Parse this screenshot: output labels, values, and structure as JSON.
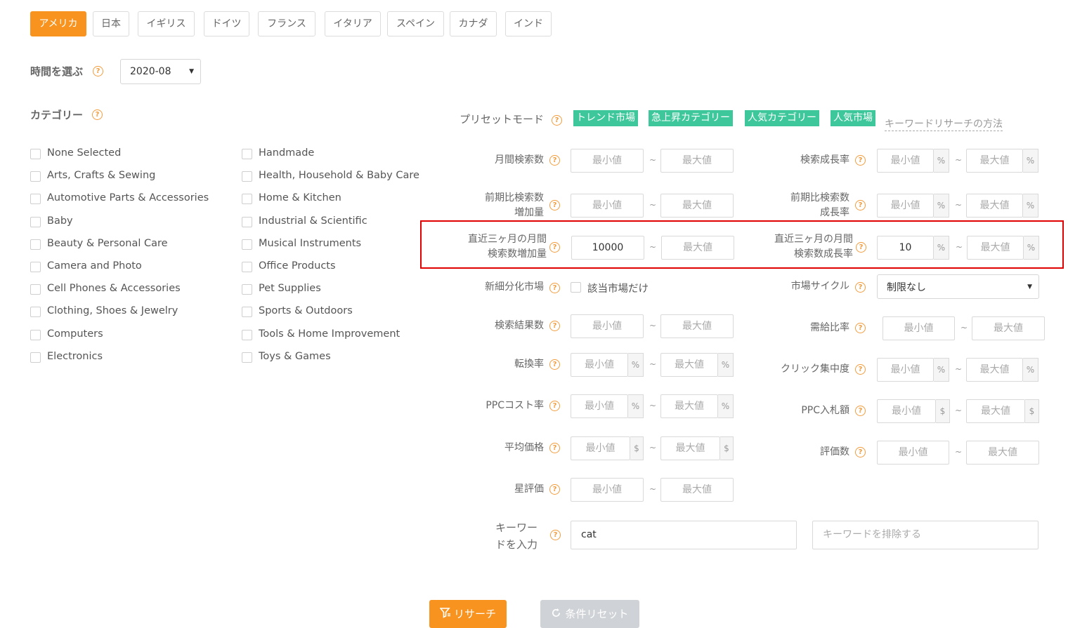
{
  "country_tabs": [
    {
      "label": "アメリカ",
      "active": true
    },
    {
      "label": "日本"
    },
    {
      "label": "イギリス"
    },
    {
      "label": "ドイツ"
    },
    {
      "label": "フランス"
    },
    {
      "label": "イタリア"
    },
    {
      "label": "スペイン"
    },
    {
      "label": "カナダ"
    },
    {
      "label": "インド"
    }
  ],
  "time": {
    "label": "時間を選ぶ",
    "value": "2020-08"
  },
  "category": {
    "label": "カテゴリー",
    "left": [
      "None Selected",
      "Arts, Crafts & Sewing",
      "Automotive Parts & Accessories",
      "Baby",
      "Beauty & Personal Care",
      "Camera and Photo",
      "Cell Phones & Accessories",
      "Clothing, Shoes & Jewelry",
      "Computers",
      "Electronics"
    ],
    "right": [
      "Handmade",
      "Health, Household & Baby Care",
      "Home & Kitchen",
      "Industrial & Scientific",
      "Musical Instruments",
      "Office Products",
      "Pet Supplies",
      "Sports & Outdoors",
      "Tools & Home Improvement",
      "Toys & Games"
    ]
  },
  "preset": {
    "label": "プリセットモード",
    "tags": [
      "トレンド市場",
      "急上昇カテゴリー",
      "人気カテゴリー",
      "人気市場"
    ],
    "link": "キーワードリサーチの方法"
  },
  "placeholders": {
    "min": "最小値",
    "max": "最大値"
  },
  "units": {
    "percent": "%",
    "dollar": "$"
  },
  "tilde": "~",
  "filters": {
    "monthly_search": "月間検索数",
    "search_growth": "検索成長率",
    "prev_increase_1": "前期比検索数",
    "prev_increase_2": "増加量",
    "prev_growth_1": "前期比検索数",
    "prev_growth_2": "成長率",
    "recent_increase_1": "直近三ヶ月の月間",
    "recent_increase_2": "検索数増加量",
    "recent_increase_min": "10000",
    "recent_growth_1": "直近三ヶ月の月間",
    "recent_growth_2": "検索数成長率",
    "recent_growth_min": "10",
    "new_segment": "新細分化市場",
    "new_segment_cb": "該当市場だけ",
    "market_cycle": "市場サイクル",
    "market_cycle_value": "制限なし",
    "results": "検索結果数",
    "supply_ratio": "需給比率",
    "conversion": "転換率",
    "click_conc": "クリック集中度",
    "ppc_cost": "PPCコスト率",
    "ppc_bid": "PPC入札額",
    "avg_price": "平均価格",
    "reviews": "評価数",
    "stars": "星評価",
    "keyword_1": "キーワー",
    "keyword_2": "ドを入力",
    "keyword_value": "cat",
    "exclude_placeholder": "キーワードを排除する"
  },
  "buttons": {
    "research": "リサーチ",
    "reset": "条件リセット"
  },
  "colors": {
    "accent": "#f7931e",
    "tag": "#3ec79a",
    "highlight": "#e00000"
  }
}
